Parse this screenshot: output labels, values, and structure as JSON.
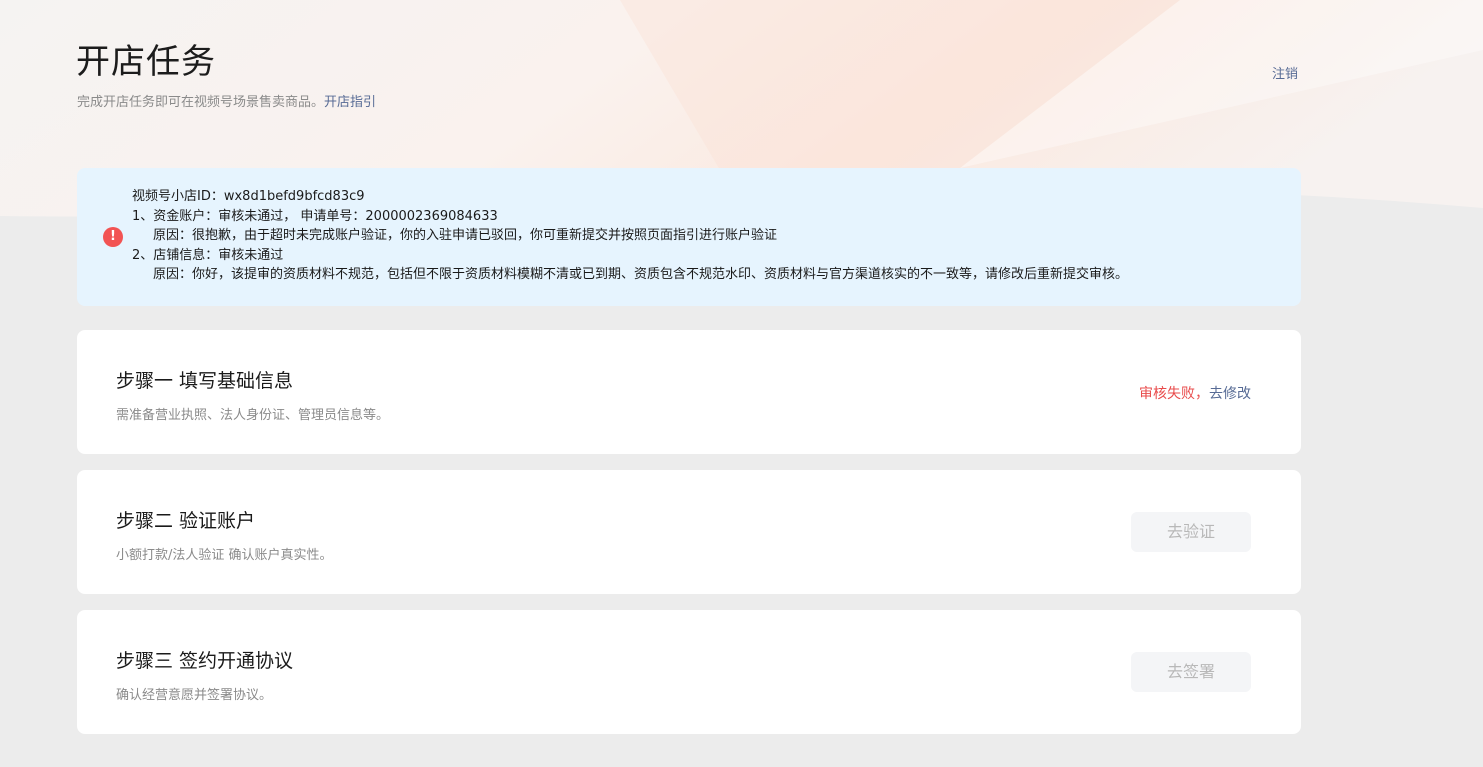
{
  "header": {
    "title": "开店任务",
    "subtitle": "完成开店任务即可在视频号场景售卖商品。",
    "guide_link": "开店指引",
    "logout": "注销"
  },
  "alert": {
    "icon": "exclamation-circle-icon",
    "icon_glyph": "!",
    "icon_color": "#f25353",
    "lines": [
      "视频号小店ID：wx8d1befd9bfcd83c9",
      "1、资金账户：审核未通过， 申请单号：2000002369084633",
      "原因：很抱歉，由于超时未完成账户验证，你的入驻申请已驳回，你可重新提交并按照页面指引进行账户验证",
      "2、店铺信息：审核未通过",
      "原因：你好，该提审的资质材料不规范，包括但不限于资质材料模糊不清或已到期、资质包含不规范水印、资质材料与官方渠道核实的不一致等，请修改后重新提交审核。"
    ]
  },
  "steps": [
    {
      "title": "步骤一 填写基础信息",
      "desc": "需准备营业执照、法人身份证、管理员信息等。",
      "status_fail": "审核失败，",
      "action_link": "去修改"
    },
    {
      "title": "步骤二 验证账户",
      "desc": "小额打款/法人验证 确认账户真实性。",
      "button": "去验证"
    },
    {
      "title": "步骤三 签约开通协议",
      "desc": "确认经营意愿并签署协议。",
      "button": "去签署"
    }
  ],
  "colors": {
    "link": "#576b95",
    "fail": "#e84b4b",
    "alert_bg": "#e6f4fe",
    "page_bg": "#ececec"
  }
}
